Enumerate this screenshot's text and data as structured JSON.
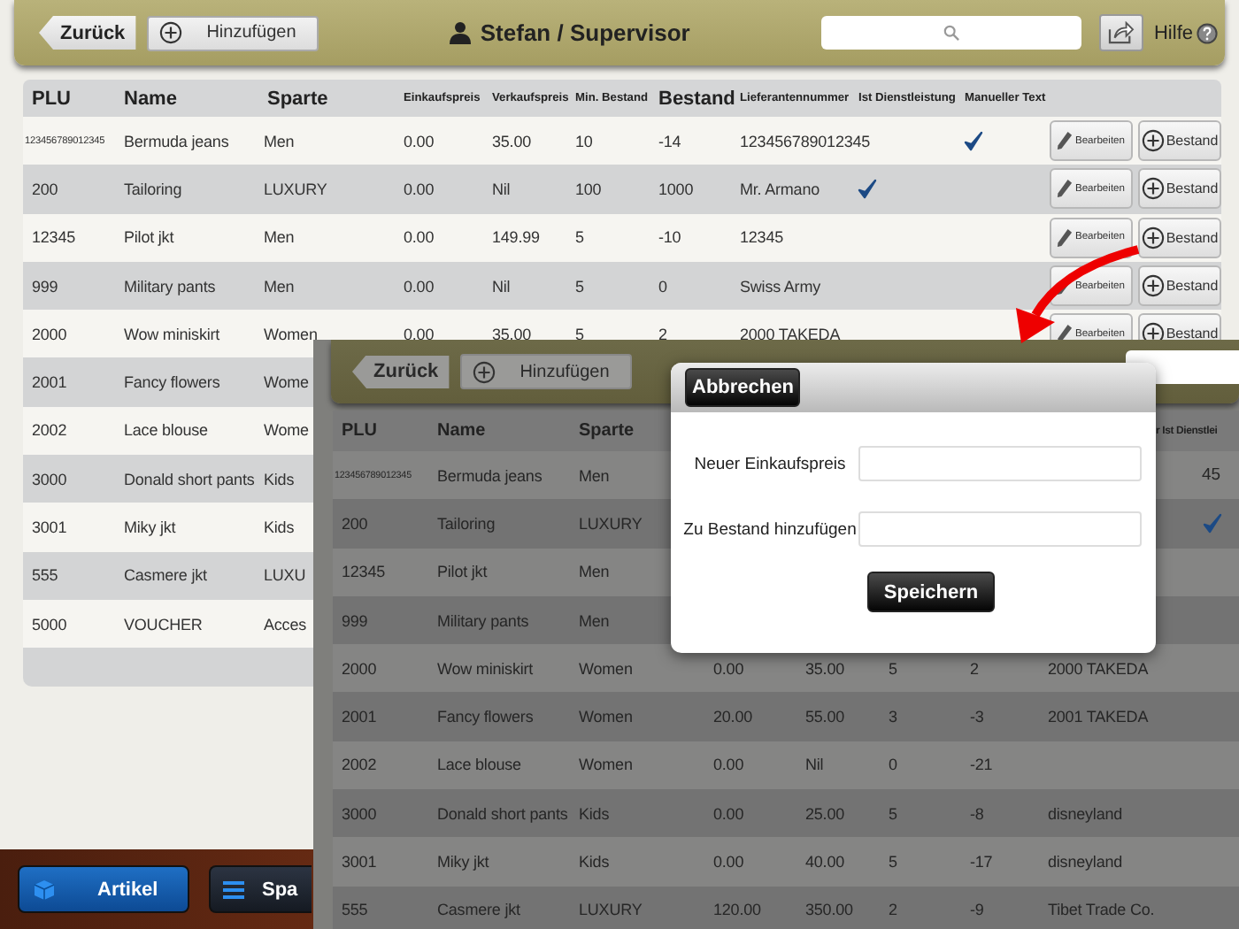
{
  "back_screen": {
    "toolbar": {
      "back_button": "Zurück",
      "add_button": "Hinzufügen",
      "user": "Stefan / Supervisor",
      "help": "Hilfe"
    },
    "table": {
      "columns": [
        "PLU",
        "Name",
        "Sparte",
        "Einkaufspreis",
        "Verkaufspreis",
        "Min. Bestand",
        "Bestand",
        "Lieferantennummer",
        "Ist Dienstleistung",
        "Manueller Text"
      ],
      "rows": [
        {
          "cells": [
            "123456789012345",
            "Bermuda jeans",
            "Men",
            "0.00",
            "35.00",
            "10",
            "-14",
            "123456789012345"
          ],
          "service": false,
          "manual_text": true,
          "edit_button": "Bearbeiten",
          "stock_button": "Bestand"
        },
        {
          "cells": [
            "200",
            "Tailoring",
            "LUXURY",
            "0.00",
            "Nil",
            "100",
            "1000",
            "Mr. Armano"
          ],
          "service": true,
          "manual_text": false,
          "edit_button": "Bearbeiten",
          "stock_button": "Bestand"
        },
        {
          "cells": [
            "12345",
            "Pilot jkt",
            "Men",
            "0.00",
            "149.99",
            "5",
            "-10",
            "12345"
          ],
          "service": false,
          "manual_text": false,
          "edit_button": "Bearbeiten",
          "stock_button": "Bestand"
        },
        {
          "cells": [
            "999",
            "Military pants",
            "Men",
            "0.00",
            "Nil",
            "5",
            "0",
            "Swiss Army"
          ],
          "service": false,
          "manual_text": false,
          "edit_button": "Bearbeiten",
          "stock_button": "Bestand"
        },
        {
          "cells": [
            "2000",
            "Wow miniskirt",
            "Women",
            "0.00",
            "35.00",
            "5",
            "2",
            "2000 TAKEDA"
          ],
          "service": false,
          "manual_text": false,
          "edit_button": "Bearbeiten",
          "stock_button": "Bestand"
        },
        {
          "cells": [
            "2001",
            "Fancy flowers",
            "Wome"
          ]
        },
        {
          "cells": [
            "2002",
            "Lace blouse",
            "Wome"
          ]
        },
        {
          "cells": [
            "3000",
            "Donald short pants",
            "Kids"
          ]
        },
        {
          "cells": [
            "3001",
            "Miky jkt",
            "Kids"
          ]
        },
        {
          "cells": [
            "555",
            "Casmere jkt",
            "LUXU"
          ]
        },
        {
          "cells": [
            "5000",
            "VOUCHER",
            "Acces"
          ]
        }
      ]
    },
    "tab_bar": [
      {
        "label": "Artikel",
        "selected": true
      },
      {
        "label": "Spa",
        "selected": false
      }
    ]
  },
  "front_screen": {
    "toolbar": {
      "back_button": "Zurück",
      "add_button": "Hinzufügen"
    },
    "table": {
      "columns": [
        "PLU",
        "Name",
        "Sparte"
      ],
      "column_right": "r Ist Dienstlei",
      "rows": [
        {
          "cells": [
            "123456789012345",
            "Bermuda jeans",
            "Men"
          ],
          "right_text": "45",
          "service": false
        },
        {
          "cells": [
            "200",
            "Tailoring",
            "LUXURY"
          ],
          "service": true
        },
        {
          "cells": [
            "12345",
            "Pilot jkt",
            "Men"
          ],
          "service": false
        },
        {
          "cells": [
            "999",
            "Military pants",
            "Men"
          ],
          "service": false
        },
        {
          "cells": [
            "2000",
            "Wow miniskirt",
            "Women",
            "0.00",
            "35.00",
            "5",
            "2",
            "2000 TAKEDA"
          ],
          "service": false
        },
        {
          "cells": [
            "2001",
            "Fancy flowers",
            "Women",
            "20.00",
            "55.00",
            "3",
            "-3",
            "2001 TAKEDA"
          ],
          "service": false
        },
        {
          "cells": [
            "2002",
            "Lace blouse",
            "Women",
            "0.00",
            "Nil",
            "0",
            "-21"
          ],
          "service": false
        },
        {
          "cells": [
            "3000",
            "Donald short pants",
            "Kids",
            "0.00",
            "25.00",
            "5",
            "-8",
            "disneyland"
          ],
          "service": false
        },
        {
          "cells": [
            "3001",
            "Miky jkt",
            "Kids",
            "0.00",
            "40.00",
            "5",
            "-17",
            "disneyland"
          ],
          "service": false
        },
        {
          "cells": [
            "555",
            "Casmere jkt",
            "LUXURY",
            "120.00",
            "350.00",
            "2",
            "-9",
            "Tibet Trade Co."
          ],
          "service": false
        }
      ]
    }
  },
  "dialog": {
    "cancel_button": "Abbrechen",
    "fields": [
      {
        "label": "Neuer Einkaufspreis"
      },
      {
        "label": "Zu Bestand hinzufügen"
      }
    ],
    "save_button": "Speichern"
  }
}
